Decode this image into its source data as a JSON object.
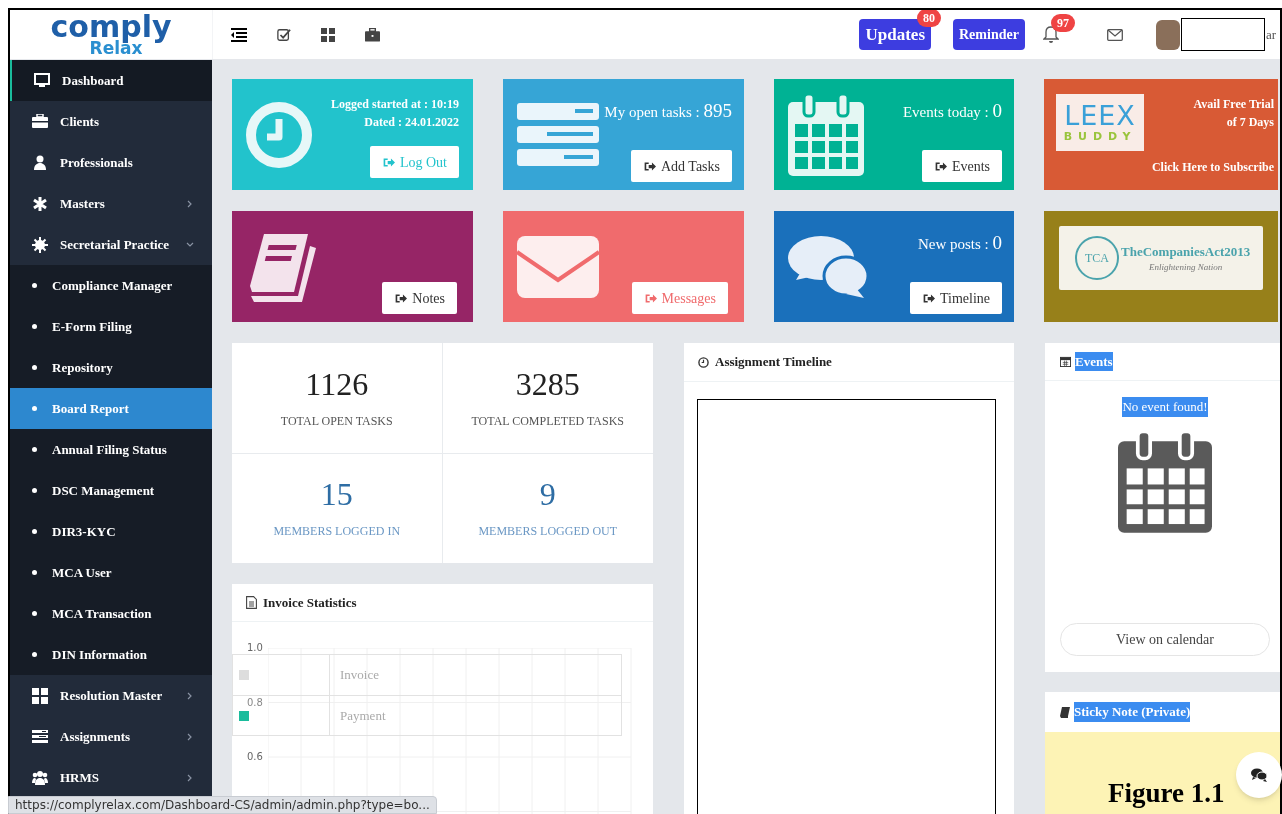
{
  "logo": {
    "word": "comply",
    "subword": "Relax"
  },
  "top_buttons": [
    {
      "label": "Updates",
      "badge": "80"
    },
    {
      "label": "Reminder"
    }
  ],
  "notifications": {
    "badge": "97"
  },
  "user": {
    "name": "ar"
  },
  "sidebar": {
    "items": [
      {
        "label": "Dashboard",
        "active": true
      },
      {
        "label": "Clients",
        "active": false
      },
      {
        "label": "Professionals",
        "active": false
      },
      {
        "label": "Masters",
        "active": false,
        "expanded": false
      },
      {
        "label": "Secretarial Practice",
        "active": false,
        "expanded": true,
        "children": [
          {
            "label": "Compliance Manager",
            "selected": false
          },
          {
            "label": "E-Form Filing",
            "selected": false
          },
          {
            "label": "Repository",
            "selected": false
          },
          {
            "label": "Board Report",
            "selected": true
          },
          {
            "label": "Annual Filing Status",
            "selected": false
          },
          {
            "label": "DSC Management",
            "selected": false
          },
          {
            "label": "DIR3-KYC",
            "selected": false
          },
          {
            "label": "MCA User",
            "selected": false
          },
          {
            "label": "MCA Transaction",
            "selected": false
          },
          {
            "label": "DIN Information",
            "selected": false
          }
        ]
      },
      {
        "label": "Resolution Master",
        "active": false,
        "expanded": false
      },
      {
        "label": "Assignments",
        "active": false,
        "expanded": false
      },
      {
        "label": "HRMS",
        "active": false,
        "expanded": false
      }
    ]
  },
  "tiles": [
    {
      "kind": "login",
      "color": "#22c3cc",
      "lines": [
        "Logged started at : 10:19",
        "Dated : 24.01.2022"
      ],
      "button": {
        "label": "Log Out",
        "tinted": true
      }
    },
    {
      "kind": "counter",
      "color": "#36a5d6",
      "label": "My open tasks :",
      "value": "895",
      "button": {
        "label": "Add Tasks",
        "tinted": false
      }
    },
    {
      "kind": "counter",
      "color": "#00b294",
      "label": "Events today :",
      "value": "0",
      "button": {
        "label": "Events",
        "tinted": false
      }
    },
    {
      "kind": "promo",
      "color": "#d85a35",
      "logo": {
        "word": "LEEX",
        "subword": "BUDDY"
      },
      "lines": [
        "Avail Free Trial",
        "of 7 Days"
      ],
      "link": "Click Here to Subscribe"
    },
    {
      "kind": "button",
      "color": "#962566",
      "button": {
        "label": "Notes",
        "tinted": false
      }
    },
    {
      "kind": "button",
      "color": "#f06b6d",
      "button": {
        "label": "Messages",
        "tinted": true
      }
    },
    {
      "kind": "counter",
      "color": "#1a70bb",
      "label": "New posts :",
      "value": "0",
      "button": {
        "label": "Timeline",
        "tinted": false
      }
    },
    {
      "kind": "banner",
      "color": "#97801a",
      "logo": {
        "mark": "TCA",
        "word": "TheCompaniesAct2013",
        "tagline": "Enlightening Nation"
      }
    }
  ],
  "stats": [
    {
      "kind": "total",
      "value": "1126",
      "label": "TOTAL OPEN TASKS"
    },
    {
      "kind": "total",
      "value": "3285",
      "label": "TOTAL COMPLETED TASKS"
    },
    {
      "kind": "members",
      "value": "15",
      "label": "MEMBERS LOGGED IN"
    },
    {
      "kind": "members",
      "value": "9",
      "label": "MEMBERS LOGGED OUT"
    }
  ],
  "invoice_statistics": {
    "title": "Invoice Statistics",
    "y_tick_labels": [
      "1.0",
      "0.8",
      "0.6"
    ],
    "legend": [
      {
        "label": "Invoice",
        "color": "#dddddd"
      },
      {
        "label": "Payment",
        "color": "#1abc9c"
      }
    ]
  },
  "assignment_timeline": {
    "title": "Assignment Timeline"
  },
  "events": {
    "title": "Events",
    "title_selected": true,
    "empty_message": "No event found!",
    "message_selected": true,
    "button": "View on calendar"
  },
  "sticky_note": {
    "title": "Sticky Note (Private)",
    "title_selected": true
  },
  "status_url": "https://complyrelax.com/Dashboard-CS/admin/admin.php?type=bo...",
  "caption": "Figure 1.1"
}
